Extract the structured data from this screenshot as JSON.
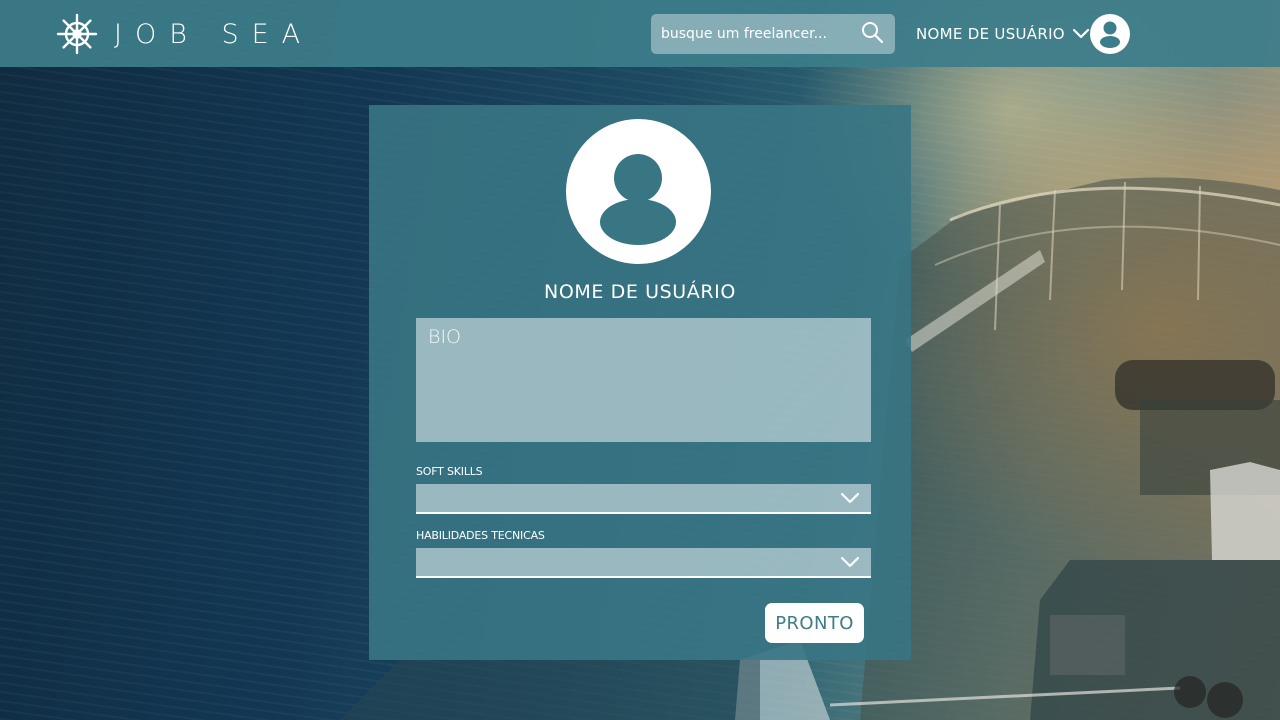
{
  "header": {
    "brand": "JOB SEA",
    "logo_icon": "ship-wheel-icon",
    "search": {
      "placeholder": "busque um freelancer...",
      "value": "",
      "icon": "search-icon"
    },
    "user_menu": {
      "username": "NOME DE USUÁRIO",
      "icon": "chevron-down-icon",
      "avatar_icon": "user-avatar-icon"
    }
  },
  "profile": {
    "avatar_icon": "user-avatar-icon",
    "username": "NOME DE USUÁRIO",
    "bio": {
      "placeholder": "BIO",
      "value": ""
    },
    "soft_skills": {
      "label": "SOFT SKILLS",
      "selected": ""
    },
    "technical_skills": {
      "label": "HABILIDADES TECNICAS",
      "selected": ""
    },
    "done_label": "PRONTO"
  },
  "colors": {
    "header_bg": "#3c7d8a",
    "panel_bg": "#387684",
    "field_bg": "#c8dade",
    "button_text": "#3d7c88"
  }
}
